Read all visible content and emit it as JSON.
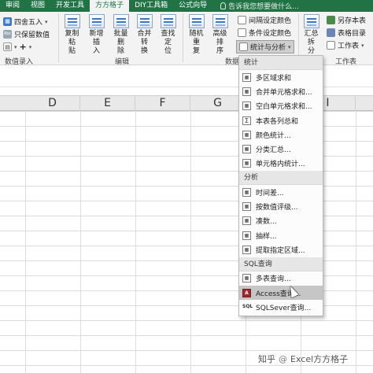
{
  "tabs": [
    {
      "label": "审阅",
      "active": false
    },
    {
      "label": "视图",
      "active": false
    },
    {
      "label": "开发工具",
      "active": false
    },
    {
      "label": "方方格子",
      "active": true
    },
    {
      "label": "DIY工具箱",
      "active": false
    },
    {
      "label": "公式向导",
      "active": false
    }
  ],
  "tell_me": "告诉我您想要做什么...",
  "ribbon": {
    "numeric_group": {
      "round": "四舍五入",
      "keep_value": "只保留数值",
      "ops_symbols": [
        "+",
        "-",
        "×",
        "÷"
      ],
      "caption": "数值录入"
    },
    "edit_group": {
      "buttons": [
        {
          "label1": "复制粘",
          "label2": "贴"
        },
        {
          "label1": "新增插",
          "label2": "入"
        },
        {
          "label1": "批量删",
          "label2": "除"
        },
        {
          "label1": "合并转",
          "label2": "换"
        },
        {
          "label1": "查找定",
          "label2": "位"
        }
      ],
      "caption": "编辑"
    },
    "data_group": {
      "buttons": [
        {
          "label1": "随机重",
          "label2": "复"
        },
        {
          "label1": "高级排",
          "label2": "序"
        }
      ],
      "caption": "数据"
    },
    "color_group": {
      "items": [
        "间隔设定颜色",
        "条件设定颜色",
        "统计与分析"
      ]
    },
    "summary_group": {
      "label1": "汇总拆",
      "label2": "分"
    },
    "sheet_group": {
      "items": [
        "另存本表",
        "表格目录",
        "工作表"
      ],
      "caption": "工作表"
    }
  },
  "columns": [
    "D",
    "E",
    "F",
    "G",
    "I"
  ],
  "menu": {
    "sections": [
      {
        "title": "统计",
        "items": [
          {
            "label": "多区域求和",
            "icon": "sheet-icon"
          },
          {
            "label": "合并单元格求和...",
            "icon": "sheet-icon"
          },
          {
            "label": "空白单元格求和...",
            "icon": "sheet-icon"
          },
          {
            "label": "本表各列总和",
            "icon": "sigma-icon"
          },
          {
            "label": "颜色统计...",
            "icon": "sheet-icon"
          },
          {
            "label": "分类汇总...",
            "icon": "sheet-icon"
          },
          {
            "label": "单元格内统计...",
            "icon": "sheet-icon"
          }
        ]
      },
      {
        "title": "分析",
        "items": [
          {
            "label": "时间差...",
            "icon": "sheet-icon"
          },
          {
            "label": "按数值评级...",
            "icon": "sheet-icon"
          },
          {
            "label": "凑数...",
            "icon": "sheet-icon"
          },
          {
            "label": "抽样...",
            "icon": "sheet-icon"
          },
          {
            "label": "提取指定区域...",
            "icon": "sheet-icon"
          }
        ]
      },
      {
        "title": "SQL查询",
        "items": [
          {
            "label": "多表查询...",
            "icon": "sheet-icon"
          },
          {
            "label": "Access查询...",
            "icon": "access-icon",
            "hover": true
          },
          {
            "label": "SQLSever查询...",
            "icon": "sql-icon"
          }
        ]
      }
    ]
  },
  "watermark": {
    "brand": "知乎",
    "at": "@",
    "account": "Excel方方格子"
  },
  "colors": {
    "tab_green": "#217346",
    "ribbon_bg": "#f3f3f3",
    "menu_hover": "#c6c6c6"
  }
}
